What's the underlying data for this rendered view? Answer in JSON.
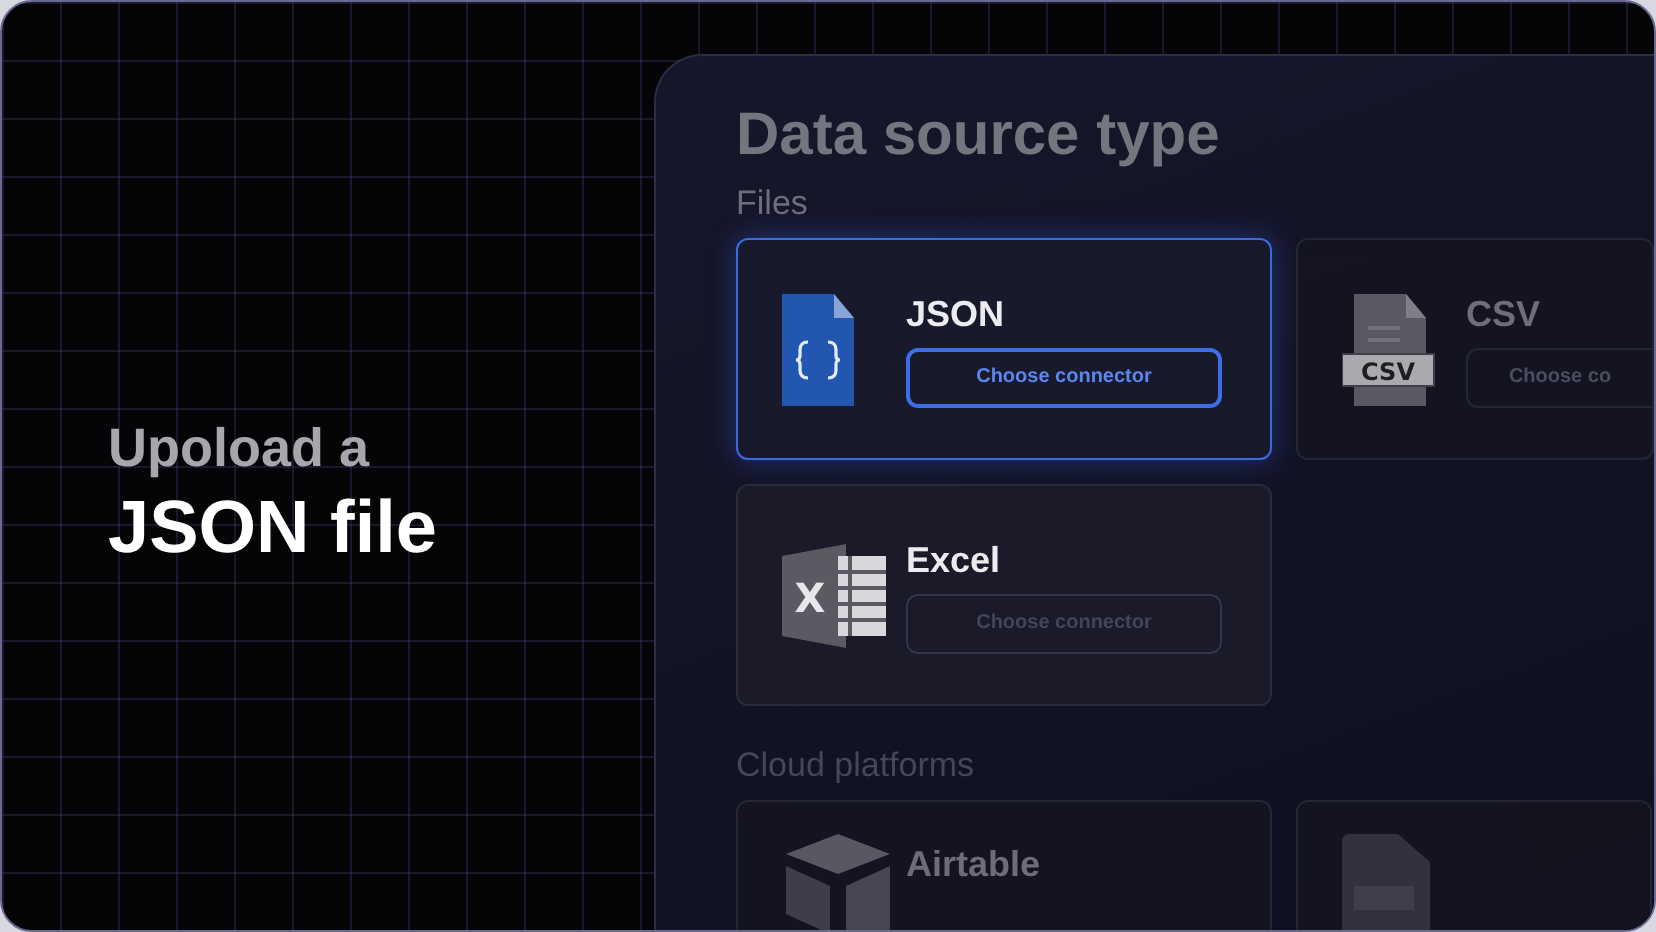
{
  "headline": {
    "lead": "Upoload a",
    "main": "JSON file"
  },
  "panel": {
    "title": "Data source type",
    "sections": [
      {
        "label": "Files",
        "faded": false,
        "cards": [
          {
            "kind": "json",
            "name": "JSON",
            "button": "Choose connector",
            "selected": true,
            "faded": false
          },
          {
            "kind": "csv",
            "icon_label": "CSV",
            "name": "CSV",
            "button": "Choose co",
            "selected": false,
            "faded": true
          },
          {
            "kind": "excel",
            "icon_label": "X",
            "name": "Excel",
            "button": "Choose connector",
            "selected": false,
            "faded": false
          }
        ]
      },
      {
        "label": "Cloud platforms",
        "faded": true,
        "cards": [
          {
            "kind": "airtable",
            "name": "Airtable",
            "selected": false,
            "faded": true
          },
          {
            "kind": "doc",
            "selected": false,
            "faded": true
          }
        ]
      }
    ]
  }
}
